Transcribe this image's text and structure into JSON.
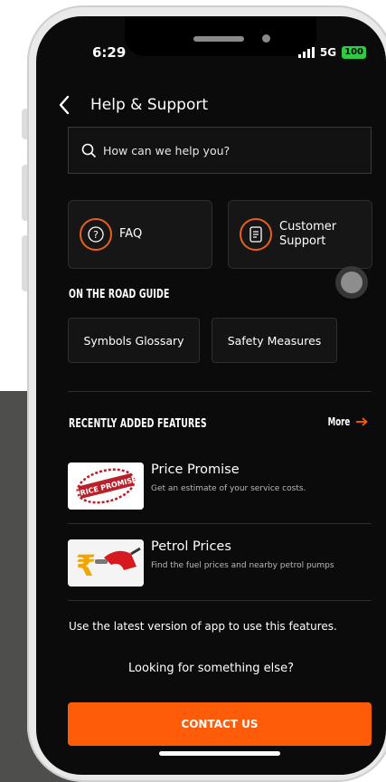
{
  "status_bar": {
    "time": "6:29",
    "network": "5G",
    "battery": "100"
  },
  "header": {
    "title": "Help & Support"
  },
  "search": {
    "placeholder": "How can we help you?"
  },
  "quick_actions": [
    {
      "label": "FAQ",
      "icon": "question-icon"
    },
    {
      "label_line1": "Customer",
      "label_line2": "Support",
      "icon": "document-icon"
    }
  ],
  "road_guide": {
    "heading": "ON THE ROAD GUIDE",
    "chips": [
      "Symbols Glossary",
      "Safety Measures"
    ]
  },
  "recent_features": {
    "heading": "RECENTLY ADDED FEATURES",
    "more_label": "More",
    "items": [
      {
        "title": "Price Promise",
        "description": "Get an estimate of your service costs.",
        "thumb_text": "PRICE PROMISE"
      },
      {
        "title": "Petrol Prices",
        "description": "Find the fuel prices and nearby petrol pumps"
      }
    ],
    "note": "Use the latest version of app to use this features."
  },
  "footer": {
    "prompt": "Looking for something else?",
    "cta_label": "CONTACT US"
  },
  "colors": {
    "accent": "#ff5c0a",
    "background": "#0b0b0b"
  }
}
